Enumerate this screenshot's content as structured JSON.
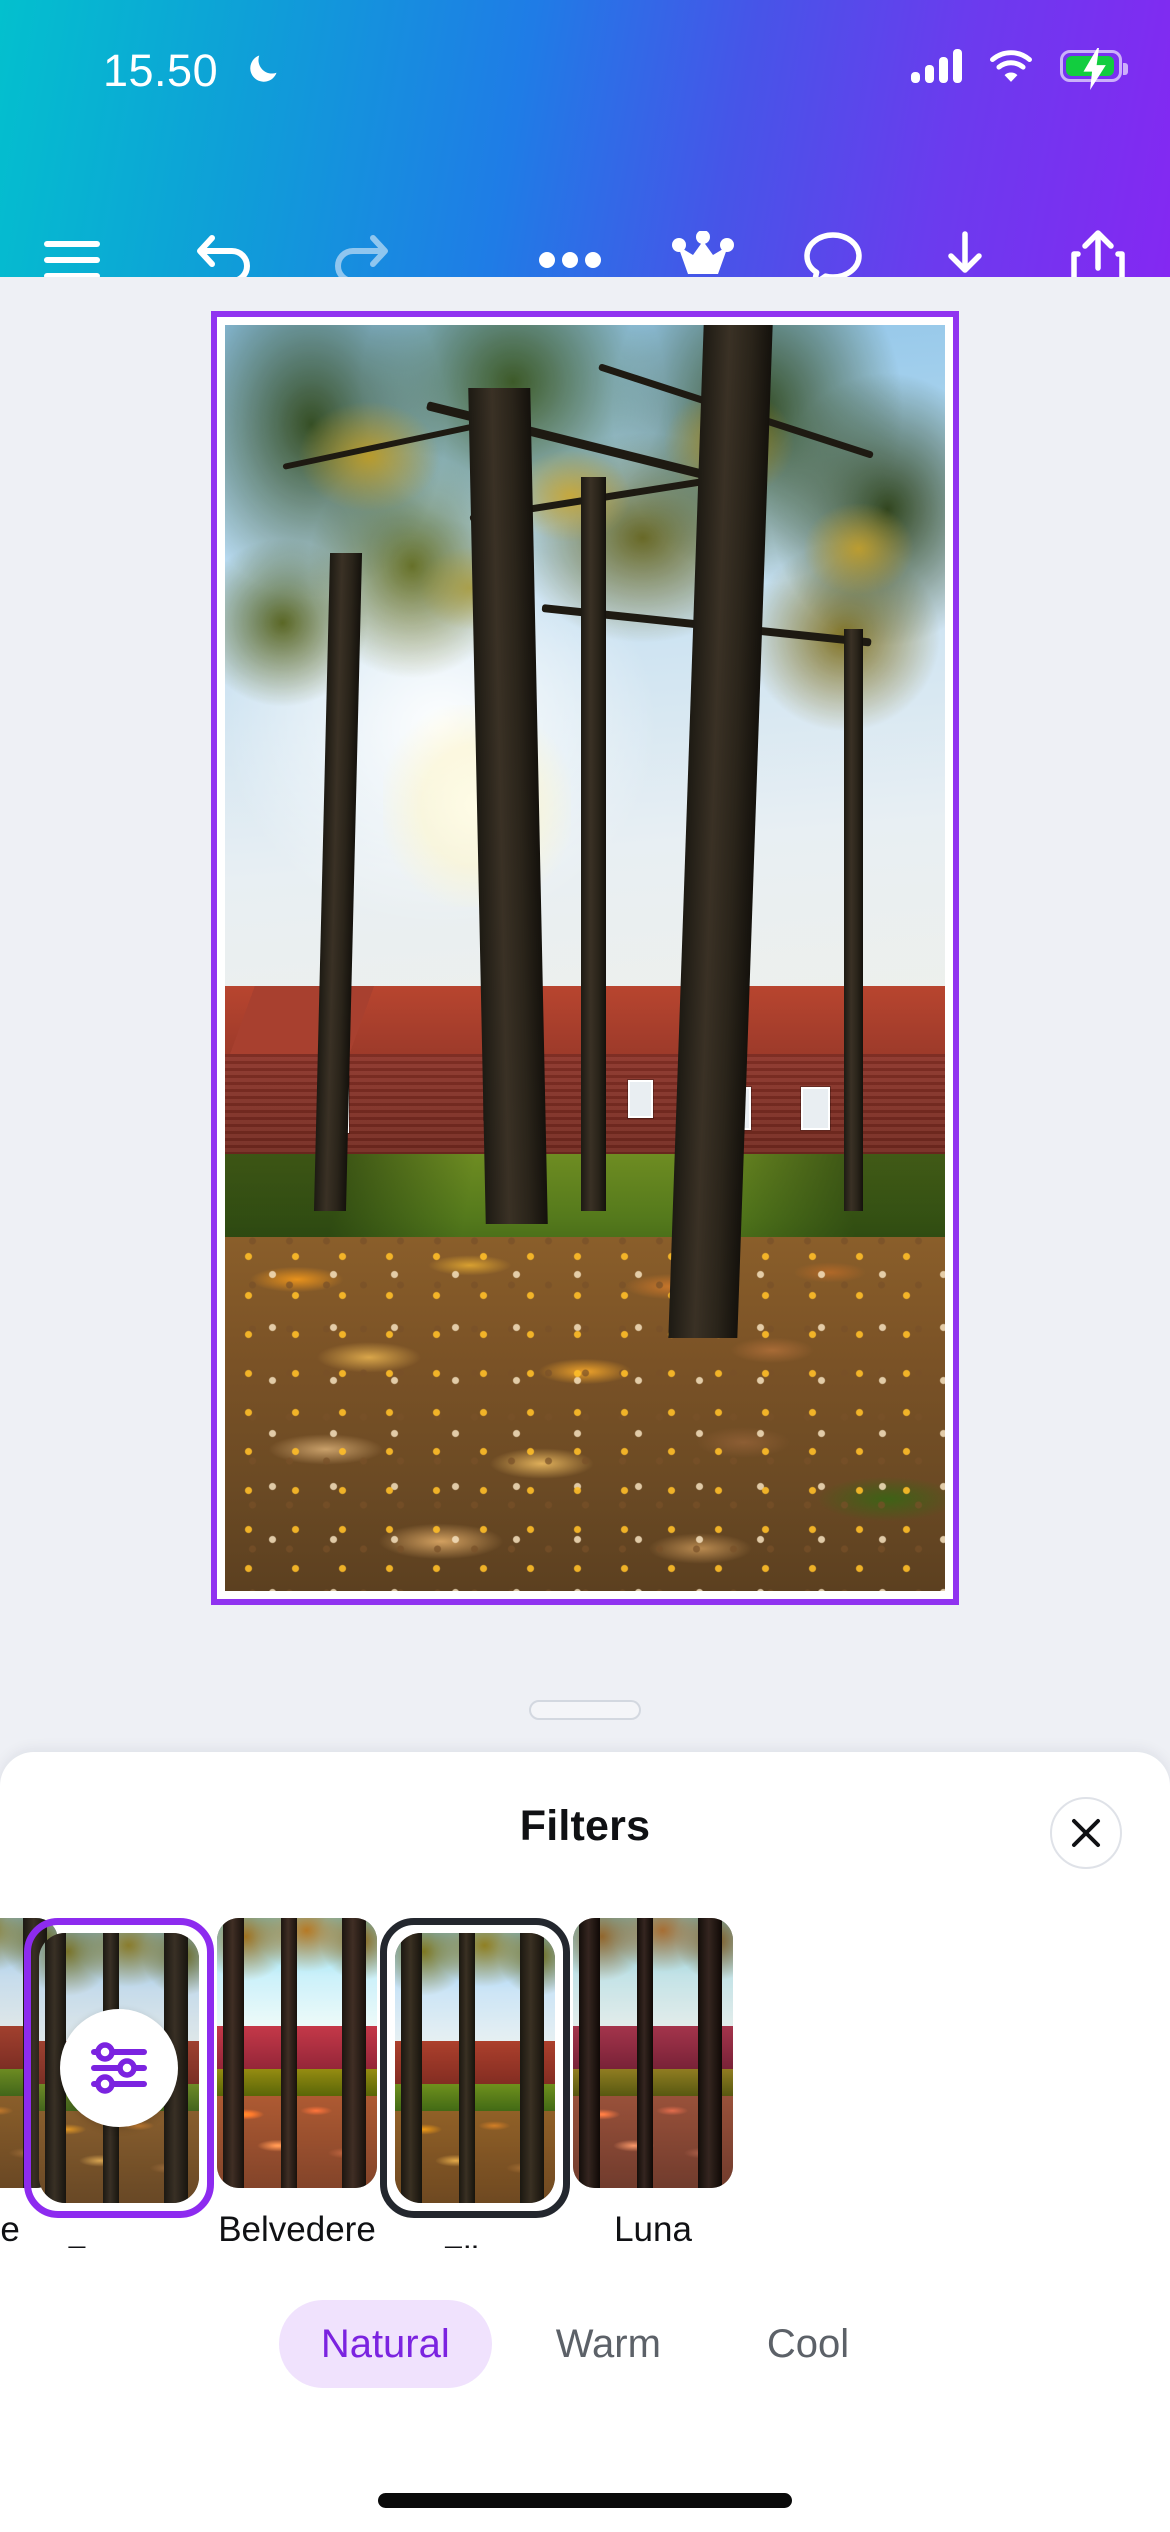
{
  "status_bar": {
    "time": "15.50",
    "do_not_disturb_icon": "moon-icon",
    "signal_icon": "cellular-signal-icon",
    "signal_bars": 4,
    "wifi_icon": "wifi-icon",
    "battery_icon": "battery-charging-icon",
    "battery_charging": true
  },
  "toolbar": {
    "gradient_start": "#03C0CE",
    "gradient_end": "#8428F2",
    "items": [
      {
        "name": "menu-button",
        "icon": "hamburger-menu-icon",
        "enabled": true
      },
      {
        "name": "undo-button",
        "icon": "undo-arrow-icon",
        "enabled": true
      },
      {
        "name": "redo-button",
        "icon": "redo-arrow-icon",
        "enabled": false
      },
      {
        "name": "more-options-button",
        "icon": "ellipsis-icon",
        "enabled": true
      },
      {
        "name": "pro-crown-button",
        "icon": "crown-icon",
        "enabled": true
      },
      {
        "name": "comments-button",
        "icon": "speech-bubble-icon",
        "enabled": true
      },
      {
        "name": "download-button",
        "icon": "download-arrow-icon",
        "enabled": true
      },
      {
        "name": "share-button",
        "icon": "share-upload-icon",
        "enabled": true
      }
    ]
  },
  "canvas": {
    "background_color": "#EEF0F5",
    "selection_border_color": "#9033F0",
    "image_alt": "autumn park with fallen orange leaves, trees and red tiled houses"
  },
  "sheet": {
    "handle": "drag-handle",
    "title": "Filters",
    "close_label": "✕"
  },
  "filters": {
    "selected": "Fresco",
    "highlighted": "Flint",
    "selected_border_color": "#8D2BEF",
    "highlighted_border_color": "#23272E",
    "adjust_icon": "sliders-adjust-icon",
    "items": [
      {
        "label": "None",
        "tone": "f-none",
        "state": "partial"
      },
      {
        "label": "Fresco",
        "tone": "f-fresco",
        "state": "selected"
      },
      {
        "label": "Belvedere",
        "tone": "f-belvedere",
        "state": "normal"
      },
      {
        "label": "Flint",
        "tone": "f-flint",
        "state": "highlighted"
      },
      {
        "label": "Luna",
        "tone": "f-luna",
        "state": "normal"
      }
    ]
  },
  "categories": {
    "active": "Natural",
    "active_bg": "#F0E2FD",
    "active_color": "#7B23E0",
    "items": [
      {
        "label": "Natural",
        "active": true
      },
      {
        "label": "Warm",
        "active": false
      },
      {
        "label": "Cool",
        "active": false
      }
    ]
  },
  "system": {
    "home_indicator": "home-indicator"
  }
}
